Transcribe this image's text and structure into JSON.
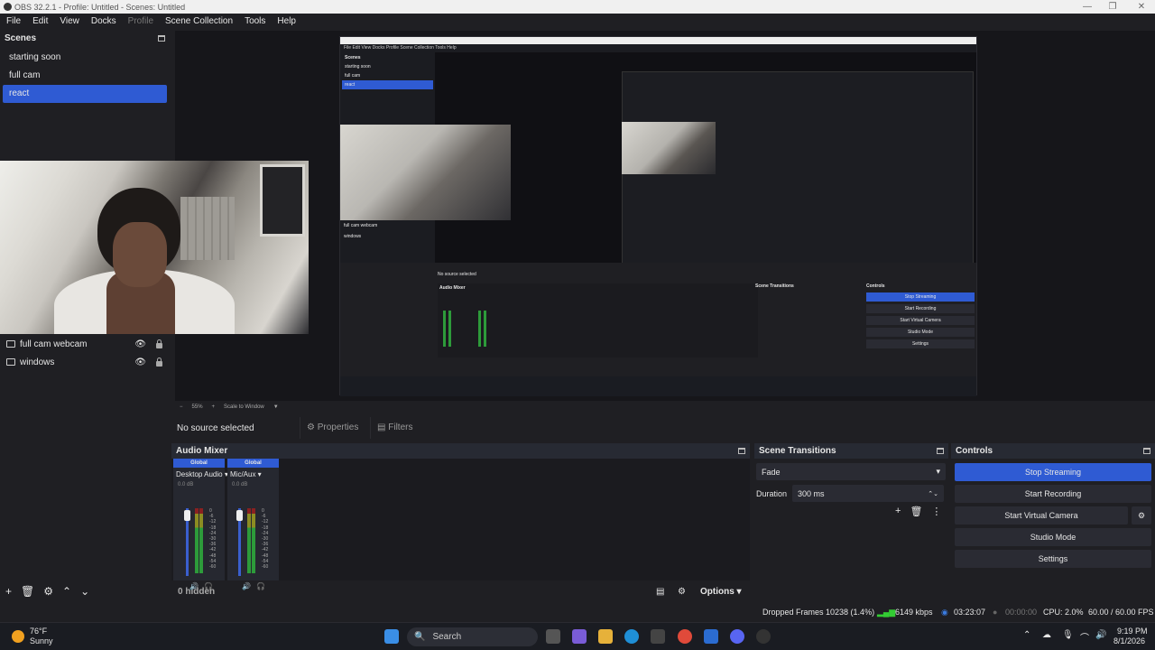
{
  "window": {
    "title": "OBS 32.2.1 - Profile: Untitled - Scenes: Untitled"
  },
  "menu": [
    "File",
    "Edit",
    "View",
    "Docks",
    "Profile",
    "Scene Collection",
    "Tools",
    "Help"
  ],
  "scenes": {
    "title": "Scenes",
    "items": [
      "starting soon",
      "full cam",
      "react"
    ],
    "active": "react"
  },
  "sources": {
    "items": [
      "full cam webcam",
      "windows"
    ]
  },
  "preview": {
    "zoom": "55%",
    "scale_mode": "Scale to Window",
    "nested_scenes": [
      "starting soon",
      "full cam",
      "react"
    ],
    "nested_sources": [
      "full cam webcam",
      "windows"
    ]
  },
  "context": {
    "no_source": "No source selected",
    "properties": "Properties",
    "filters": "Filters"
  },
  "mixer": {
    "title": "Audio Mixer",
    "channels": [
      {
        "global": "Global",
        "name": "Desktop Audio",
        "db": "0.0 dB"
      },
      {
        "global": "Global",
        "name": "Mic/Aux",
        "db": "0.0 dB"
      }
    ],
    "ticks": [
      "0",
      "-6",
      "-12",
      "-18",
      "-24",
      "-30",
      "-36",
      "-42",
      "-48",
      "-54",
      "-60"
    ],
    "hidden": "0 hidden",
    "options": "Options"
  },
  "transitions": {
    "title": "Scene Transitions",
    "selected": "Fade",
    "duration_label": "Duration",
    "duration_value": "300 ms"
  },
  "controls": {
    "title": "Controls",
    "stop_streaming": "Stop Streaming",
    "start_recording": "Start Recording",
    "start_virtual_camera": "Start Virtual Camera",
    "studio_mode": "Studio Mode",
    "settings": "Settings"
  },
  "status": {
    "dropped_frames": "Dropped Frames 10238 (1.4%)",
    "bitrate": "6149 kbps",
    "stream_time": "03:23:07",
    "record_time": "00:00:00",
    "cpu": "CPU: 2.0%",
    "fps": "60.00 / 60.00 FPS"
  },
  "taskbar": {
    "weather_temp": "76°F",
    "weather_desc": "Sunny",
    "search": "Search",
    "time": "9:19 PM",
    "date": "8/1/2026"
  },
  "colors": {
    "accent": "#2f5bd3",
    "bg": "#1f1f23",
    "panel": "#272a33"
  }
}
